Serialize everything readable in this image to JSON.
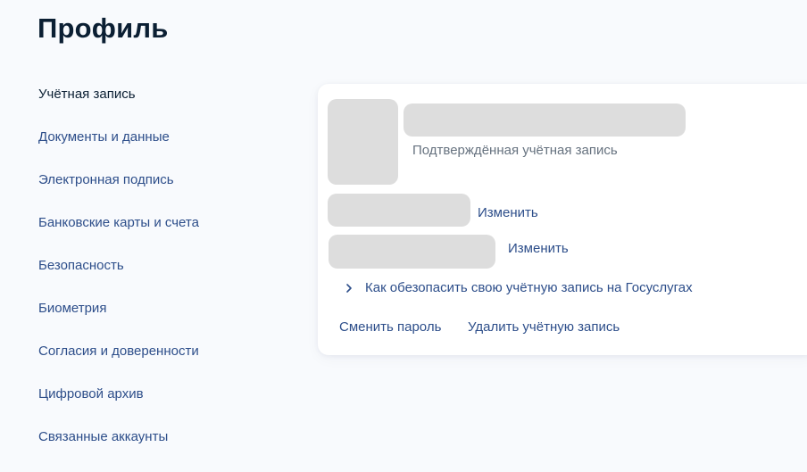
{
  "page": {
    "title": "Профиль"
  },
  "sidebar": {
    "items": [
      {
        "label": "Учётная запись",
        "active": true
      },
      {
        "label": "Документы и данные"
      },
      {
        "label": "Электронная подпись"
      },
      {
        "label": "Банковские карты и счета"
      },
      {
        "label": "Безопасность"
      },
      {
        "label": "Биометрия"
      },
      {
        "label": "Согласия и доверенности"
      },
      {
        "label": "Цифровой архив"
      },
      {
        "label": "Связанные аккаунты"
      }
    ]
  },
  "account": {
    "status": "Подтверждённая учётная запись",
    "fields": [
      {
        "action_label": "Изменить"
      },
      {
        "action_label": "Изменить"
      }
    ],
    "security_link": "Как обезопасить свою учётную запись на Госуслугах",
    "actions": {
      "change_password": "Сменить пароль",
      "delete_account": "Удалить учётную запись"
    }
  },
  "colors": {
    "text_primary": "#0b1f33",
    "link": "#2d4e8a",
    "muted": "#66727f",
    "skeleton": "#dddddd",
    "background": "#f8fafd"
  },
  "icons": {
    "expand": "chevron-right-icon"
  }
}
